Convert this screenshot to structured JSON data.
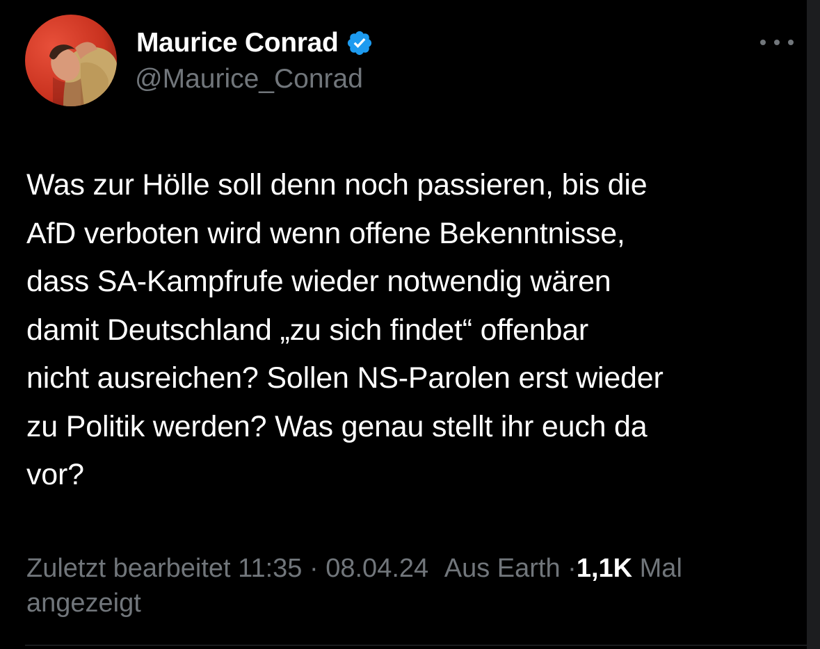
{
  "author": {
    "display_name": "Maurice Conrad",
    "handle": "@Maurice_Conrad",
    "verified_icon": "verified-badge-icon",
    "avatar_icon": "profile-photo"
  },
  "tweet": {
    "text_lines": [
      "Was zur Hölle soll denn noch passieren, bis die",
      "AfD verboten wird wenn offene Bekenntnisse,",
      "dass SA-Kampfrufe wieder notwendig wären",
      "damit Deutschland „zu sich findet“ offenbar",
      "nicht ausreichen? Sollen NS-Parolen erst wieder",
      "zu Politik werden? Was genau stellt ihr euch da",
      "vor?"
    ]
  },
  "meta": {
    "edited_prefix": "Zuletzt bearbeitet",
    "time": "11:35",
    "separator": "·",
    "date": "08.04.24",
    "source": "Aus Earth",
    "views_count": "1,1K",
    "views_label_1": "Mal",
    "views_label_2": "angezeigt"
  },
  "colors": {
    "background": "#000000",
    "text_primary": "#ffffff",
    "text_secondary": "#71767b",
    "verified": "#1d9bf0"
  }
}
